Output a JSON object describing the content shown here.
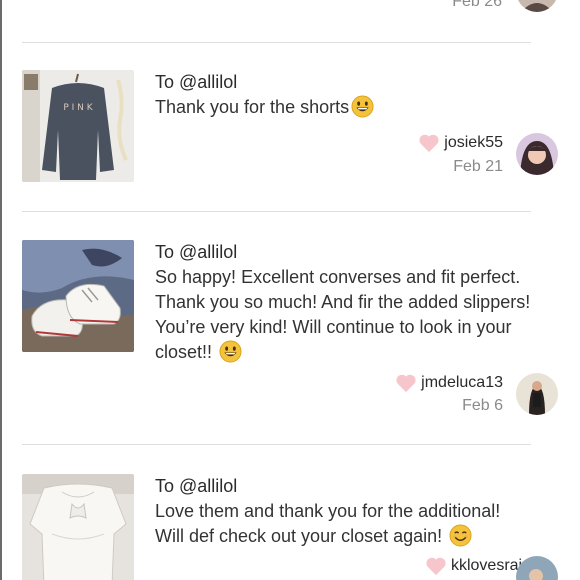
{
  "top_fragment": {
    "date": "Feb 26"
  },
  "reviews": [
    {
      "to": "To @allilol",
      "message": "Thank you for the shorts",
      "emoji": "grinning-emoji",
      "username": "josiek55",
      "date": "Feb 21"
    },
    {
      "to": "To @allilol",
      "message_lines": [
        "So happy! Excellent converses and fit perfect.",
        "Thank you so much! And fir the added slippers!",
        "You’re very kind! Will continue to look in your",
        "closet!!"
      ],
      "emoji": "grinning-emoji",
      "username": "jmdeluca13",
      "date": "Feb 6"
    },
    {
      "to": "To @allilol",
      "message_lines": [
        "Love them and thank you for the additional!",
        "Will def check out your closet again!"
      ],
      "emoji": "smiling-emoji",
      "username": "kklovesrain"
    }
  ],
  "colors": {
    "heart": "#f7c6cc",
    "date": "#8a8a8a",
    "divider": "#dedede"
  }
}
